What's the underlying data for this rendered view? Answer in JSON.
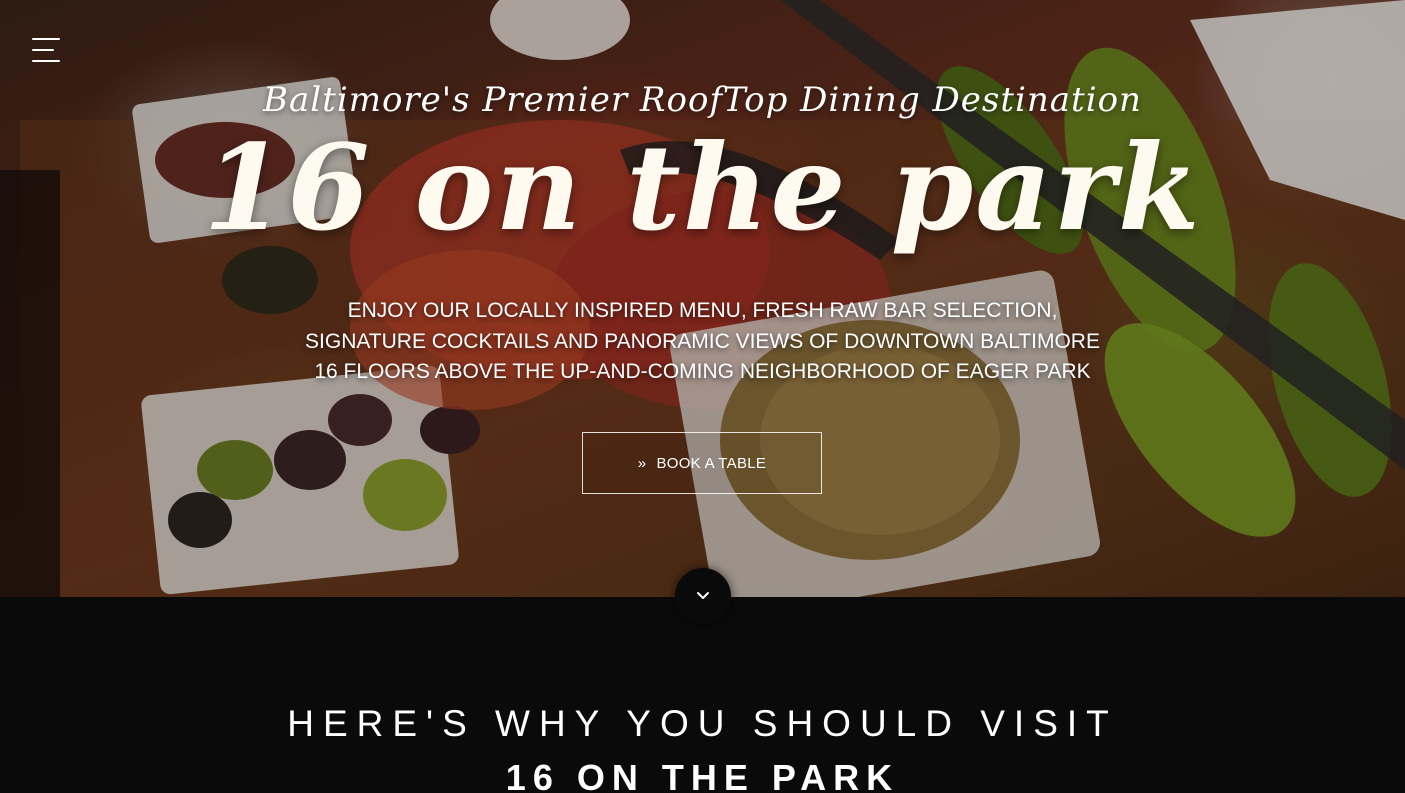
{
  "header": {
    "menu_icon": "hamburger-menu-icon"
  },
  "hero": {
    "tagline": "Baltimore's Premier RoofTop Dining Destination",
    "title": "16 on the park",
    "description_lines": [
      "ENJOY OUR LOCALLY INSPIRED MENU, FRESH RAW BAR SELECTION,",
      "SIGNATURE COCKTAILS AND PANORAMIC VIEWS OF DOWNTOWN BALTIMORE",
      "16 FLOORS ABOVE THE UP-AND-COMING NEIGHBORHOOD OF EAGER PARK"
    ],
    "cta_label": "BOOK A TABLE",
    "cta_icon": "double-chevron-right-icon",
    "cta_icon_glyph": "»",
    "scroll_icon": "chevron-down-icon"
  },
  "why": {
    "heading": "HERE'S WHY YOU SHOULD VISIT",
    "subheading": "16 ON THE PARK"
  },
  "colors": {
    "text": "#ffffff",
    "section_background": "#0a0a0a",
    "button_border": "#ffffff"
  }
}
